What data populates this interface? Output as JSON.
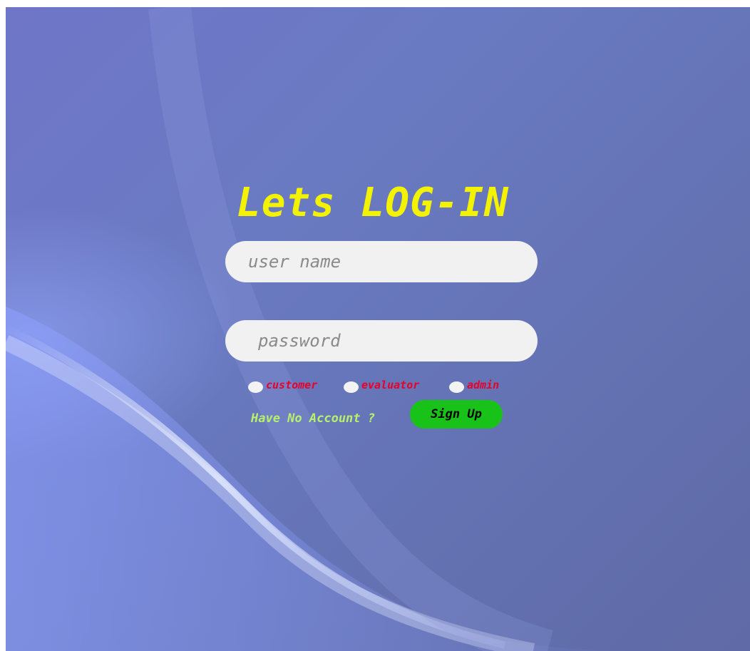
{
  "login": {
    "title": "Lets LOG-IN",
    "username_placeholder": "user name",
    "password_placeholder": "password",
    "roles": {
      "customer": "customer",
      "evaluator": "evaluator",
      "admin": "admin"
    },
    "no_account_text": "Have No Account ?",
    "signup_label": "Sign Up"
  },
  "colors": {
    "background": "#6a77c0",
    "title": "#f3f300",
    "input_bg": "#f1f1f1",
    "role_label": "#e8002a",
    "no_account": "#b7f06a",
    "signup_bg": "#18c218"
  }
}
